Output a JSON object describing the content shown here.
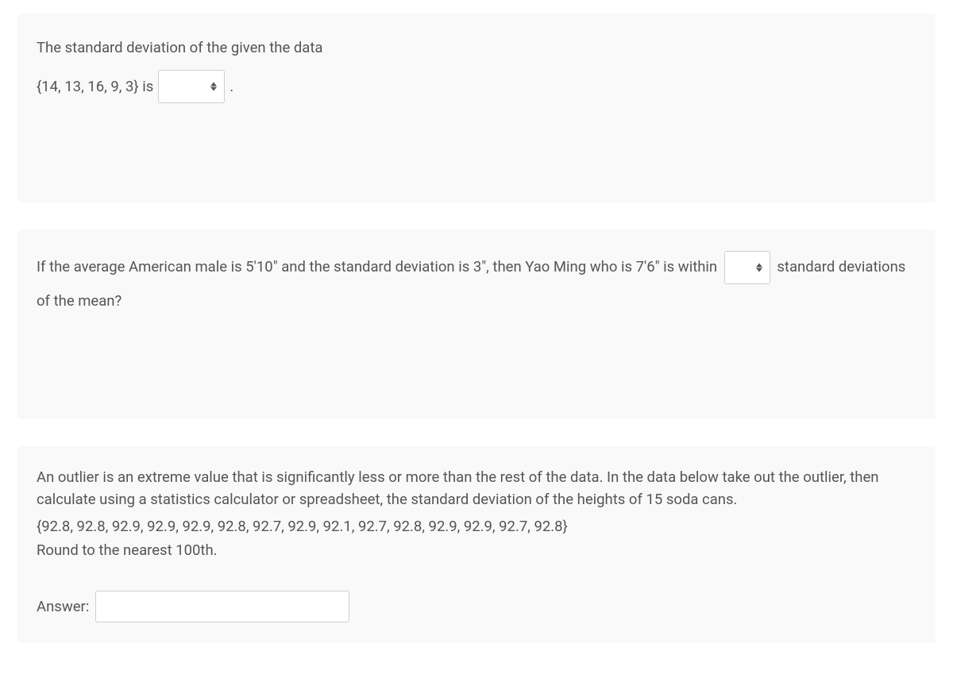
{
  "q1": {
    "text_before": "The standard deviation of the given the data",
    "data_text": "{14, 13, 16, 9, 3} is",
    "period": "."
  },
  "q2": {
    "text_before": "If the average American male is 5'10\" and the standard deviation is 3\", then Yao Ming who is 7'6\" is within",
    "text_after": "standard deviations of the mean?"
  },
  "q3": {
    "intro": "An outlier is an extreme value that is significantly less or more than the rest of the data. In the data below take out the outlier, then calculate using a statistics calculator or spreadsheet,  the standard deviation of the heights of 15 soda cans.",
    "data": "{92.8, 92.8, 92.9, 92.9, 92.9, 92.8, 92.7, 92.9, 92.1, 92.7, 92.8, 92.9, 92.9, 92.7, 92.8}",
    "round": "Round to the nearest 100th.",
    "answer_label": "Answer:"
  }
}
